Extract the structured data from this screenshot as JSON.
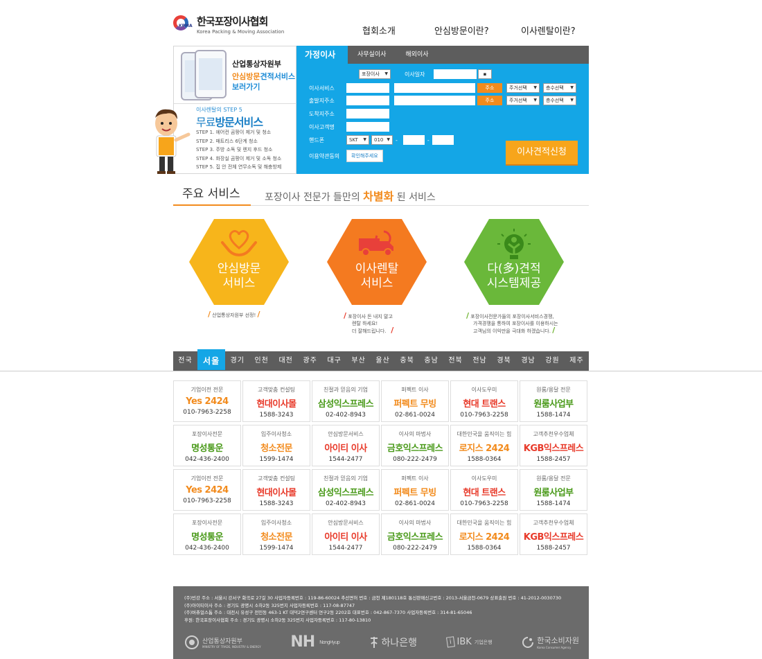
{
  "header": {
    "logo_title": "한국포장이사협회",
    "logo_sub": "Korea Packing & Moving Association",
    "logo_mark": "KPMA",
    "nav": [
      "협회소개",
      "안심방문이란?",
      "이사렌탈이란?"
    ]
  },
  "promo": {
    "gov_title": "산업통상자원부",
    "gov_link_1a": "안심방문",
    "gov_link_1b": "견적서비스",
    "gov_link_2": "보러가기",
    "step_head": "이사렌탈의 STEP 5",
    "step_big_1": "무료",
    "step_big_2": "방문서비스",
    "steps": [
      "STEP 1. 에어컨 곰팡이 제거 및 청소",
      "STEP 2. 매트리스 6단계 청소",
      "STEP 3. 주방 소독 및 렌지 후드 청소",
      "STEP 4. 화장실 곰팡이 제거 및 소독 청소",
      "STEP 5. 집 안 전체 연무소독 및 해충방제"
    ]
  },
  "form": {
    "tabs": [
      "가정이사",
      "사무실이사",
      "해외이사"
    ],
    "type_select": "포장이사",
    "date_label": "이사일자",
    "labels": [
      "이사서비스",
      "출발지주소",
      "도착지주소",
      "이사고객명",
      "핸드폰",
      "이용약관동의"
    ],
    "addr_btn": "주소",
    "house_select": "주거선택",
    "floor_select": "층수선택",
    "carrier": "SKT",
    "prefix": "010",
    "agree_btn": "확인해주세요",
    "submit": "이사견적신청"
  },
  "services": {
    "title": "주요 서비스",
    "desc_1": "포장이사 전문가 들만의",
    "desc_hl": "차별화",
    "desc_2": "된 서비스",
    "items": [
      {
        "title_1": "안심방문",
        "title_2": "서비스",
        "note_1": "산업통상자원부 선정!",
        "icon": "heart-hands-icon",
        "color": "#f7b51b"
      },
      {
        "title_1": "이사렌탈",
        "title_2": "서비스",
        "note_1": "포장이사 돈 내지 말고",
        "note_2": "렌탈 하세요!",
        "note_3": "더 잘해드립니다.",
        "icon": "truck-icon",
        "color": "#f47a20"
      },
      {
        "title_1": "다(多)견적",
        "title_2": "시스템제공",
        "note_1": "포장이사전문가들의 포장이사서비스경쟁,",
        "note_2": "가격경쟁을 통하여 포장이사를 이용하시는",
        "note_3": "고객님의 이익만을 극대화 하겠습니다.",
        "icon": "lightbulb-person-icon",
        "color": "#6ab83a"
      }
    ]
  },
  "regions": [
    "전국",
    "서울",
    "경기",
    "인천",
    "대전",
    "광주",
    "대구",
    "부산",
    "울산",
    "충북",
    "충남",
    "전북",
    "전남",
    "경북",
    "경남",
    "강원",
    "제주"
  ],
  "companies": [
    {
      "top": "기업이전 전문",
      "name": "Yes 2424",
      "tel": "010-7963-2258",
      "color": "or"
    },
    {
      "top": "고객맞춤 컨설팅",
      "name": "현대이사몰",
      "tel": "1588-3243",
      "color": "red"
    },
    {
      "top": "친절과 믿음의 기업",
      "name": "삼성익스프레스",
      "tel": "02-402-8943",
      "color": "gr"
    },
    {
      "top": "퍼펙트 이사",
      "name": "퍼펙트 무빙",
      "tel": "02-861-0024",
      "color": "or"
    },
    {
      "top": "이사도우미",
      "name": "현대 트랜스",
      "tel": "010-7963-2258",
      "color": "red"
    },
    {
      "top": "원룸/용달 전문",
      "name": "원룸사업부",
      "tel": "1588-1474",
      "color": "gr"
    },
    {
      "top": "포장이사전문",
      "name": "명성통운",
      "tel": "042-436-2400",
      "color": "gr"
    },
    {
      "top": "입주이사청소",
      "name": "청소전문",
      "tel": "1599-1474",
      "color": "or"
    },
    {
      "top": "안심방문서비스",
      "name": "아이티 이사",
      "tel": "1544-2477",
      "color": "red"
    },
    {
      "top": "이사의 마법사",
      "name": "금호익스프레스",
      "tel": "080-222-2479",
      "color": "gr"
    },
    {
      "top": "대한민국을 움직이는 힘",
      "name": "로지스 2424",
      "tel": "1588-0364",
      "color": "or"
    },
    {
      "top": "고객추천우수업체",
      "name": "KGB익스프레스",
      "tel": "1588-2457",
      "color": "red"
    },
    {
      "top": "기업이전 전문",
      "name": "Yes 2424",
      "tel": "010-7963-2258",
      "color": "or"
    },
    {
      "top": "고객맞춤 컨설팅",
      "name": "현대이사몰",
      "tel": "1588-3243",
      "color": "red"
    },
    {
      "top": "친절과 믿음의 기업",
      "name": "삼성익스프레스",
      "tel": "02-402-8943",
      "color": "gr"
    },
    {
      "top": "퍼펙트 이사",
      "name": "퍼펙트 무빙",
      "tel": "02-861-0024",
      "color": "or"
    },
    {
      "top": "이사도우미",
      "name": "현대 트랜스",
      "tel": "010-7963-2258",
      "color": "red"
    },
    {
      "top": "원룸/용달 전문",
      "name": "원룸사업부",
      "tel": "1588-1474",
      "color": "gr"
    },
    {
      "top": "포장이사전문",
      "name": "명성통운",
      "tel": "042-436-2400",
      "color": "gr"
    },
    {
      "top": "입주이사청소",
      "name": "청소전문",
      "tel": "1599-1474",
      "color": "or"
    },
    {
      "top": "안심방문서비스",
      "name": "아이티 이사",
      "tel": "1544-2477",
      "color": "red"
    },
    {
      "top": "이사의 마법사",
      "name": "금호익스프레스",
      "tel": "080-222-2479",
      "color": "gr"
    },
    {
      "top": "대한민국을 움직이는 힘",
      "name": "로지스 2424",
      "tel": "1588-0364",
      "color": "or"
    },
    {
      "top": "고객추천우수업체",
      "name": "KGB익스프레스",
      "tel": "1588-2457",
      "color": "red"
    }
  ],
  "footer": {
    "lines": [
      "(주)빈강 주소 : 서울시 강서구 화곡로 27길 30 사업자등록번호 : 119-86-60024 추선면허 번호 : 금천 제180118호 통신판매신고번호 : 2013-서울금천-0679 상표출원 번호 : 41-2012-0030730",
      "(주)아이티이사 주소 : 경기도 광명시 소하2동 325번지 사업자등록번호 : 117-08-87747",
      "(주)버츄얼스톰 주소 : 대전시 유성구 전민동 463-1 KT 대덕2연구센터 연구2동 2202호 대표번호 : 042-867-7370 사업자등록번호 : 314-81-65046",
      "후원: 한국포장이사협회 주소 : 경기도 광명시 소하2동 325번지 사업자등록번호 : 117-80-13810"
    ],
    "partners": [
      {
        "name": "산업통상자원부",
        "sub": "MINISTRY OF TRADE, INDUSTRY & ENERGY",
        "icon": "government-seal-icon"
      },
      {
        "name": "NH",
        "sub": "NongHyup"
      },
      {
        "name": "하나은행",
        "icon": "hana-icon"
      },
      {
        "name": "IBK",
        "sub": "기업은행"
      },
      {
        "name": "한국소비자원",
        "sub": "Korea Consumer Agency",
        "icon": "consumer-agency-icon"
      }
    ]
  }
}
